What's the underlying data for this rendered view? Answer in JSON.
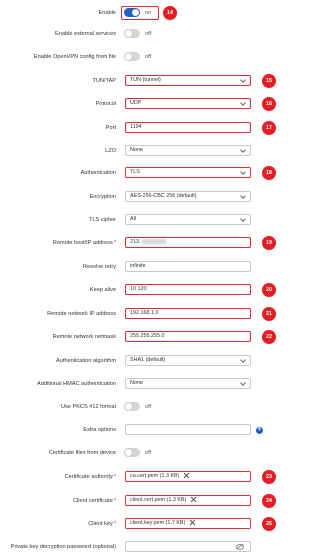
{
  "enable": {
    "label": "Enable",
    "state": "on",
    "badge": "14"
  },
  "external_services": {
    "label": "Enable external services",
    "state": "off"
  },
  "openvpn_file": {
    "label": "Enable OpenVPN config from file",
    "state": "off"
  },
  "tun_tap": {
    "label": "TUN/TAP",
    "value": "TUN (tunnel)",
    "badge": "15"
  },
  "protocol": {
    "label": "Protocol",
    "value": "UDP",
    "badge": "16"
  },
  "port": {
    "label": "Port",
    "value": "1194",
    "badge": "17"
  },
  "lzo": {
    "label": "LZO",
    "value": "None"
  },
  "authentication": {
    "label": "Authentication",
    "value": "TLS",
    "badge": "18"
  },
  "encryption": {
    "label": "Encryption",
    "value": "AES-256-CBC 256 (default)"
  },
  "tls_cipher": {
    "label": "TLS cipher",
    "value": "All"
  },
  "remote_host": {
    "label": "Remote host/IP address",
    "value": "213.",
    "badge": "19"
  },
  "resolve_retry": {
    "label": "Resolve retry",
    "value": "infinite"
  },
  "keep_alive": {
    "label": "Keep alive",
    "value": "10 120",
    "badge": "20"
  },
  "remote_network_ip": {
    "label": "Remote network IP address",
    "value": "192.168.1.0",
    "badge": "21"
  },
  "remote_netmask": {
    "label": "Remote network netmask",
    "value": "255.255.255.0",
    "badge": "22"
  },
  "auth_algorithm": {
    "label": "Authentication algorithm",
    "value": "SHA1 (default)"
  },
  "hmac_auth": {
    "label": "Additional HMAC authentication",
    "value": "None"
  },
  "pkcs12": {
    "label": "Use PKCS #12 format",
    "state": "off"
  },
  "extra_options": {
    "label": "Extra options",
    "value": ""
  },
  "cert_from_device": {
    "label": "Certificate files from device",
    "state": "off"
  },
  "ca": {
    "label": "Certificate authority",
    "value": "ca.cert.pem (1.3 KB)",
    "badge": "23"
  },
  "client_cert": {
    "label": "Client certificate",
    "value": "client.cert.pem (1.3 KB)",
    "badge": "24"
  },
  "client_key": {
    "label": "Client key",
    "value": "client.key.pem (1.7 KB)",
    "badge": "25"
  },
  "private_key_password": {
    "label": "Private key decryption password (optional)",
    "value": ""
  },
  "required_mark": "*",
  "colors": {
    "accent": "#1f63c3",
    "highlight": "#d32f2f",
    "badge": "#e31e24"
  }
}
